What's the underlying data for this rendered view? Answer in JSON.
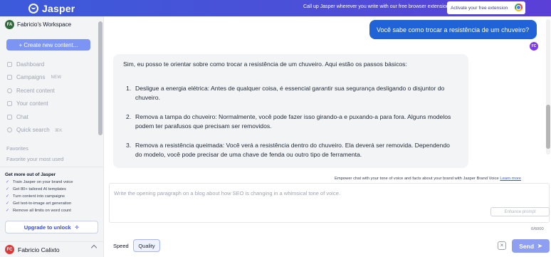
{
  "banner": {
    "brand": "Jasper",
    "message": "Call up Jasper wherever you write with our free browser extension!",
    "cta": "Activate your free extension",
    "cta_icon": "chrome-icon"
  },
  "sidebar": {
    "workspace": {
      "initials": "FA",
      "name": "Fabricio's Workspace"
    },
    "create_button": "+ Create new content...",
    "items": [
      {
        "label": "Dashboard",
        "icon": "home-icon"
      },
      {
        "label": "Campaigns",
        "icon": "campaigns-icon",
        "badge": "NEW"
      },
      {
        "label": "Recent content",
        "icon": "clock-icon"
      },
      {
        "label": "Your content",
        "icon": "folder-icon"
      },
      {
        "label": "Chat",
        "icon": "chat-icon"
      },
      {
        "label": "Quick search",
        "icon": "search-icon",
        "shortcut": "⌘K"
      }
    ],
    "favorites_title": "Favorites",
    "favorites_empty": "Favorite your most used",
    "promo": {
      "title": "Get more out of Jasper",
      "items": [
        "Train Jasper on your brand voice",
        "Get 80+ tailored AI templates",
        "Turn content into campaigns",
        "Get text-to-image art generation",
        "Remove all limits on word count"
      ]
    },
    "upgrade_button": "Upgrade to unlock",
    "user": {
      "initials": "FC",
      "name": "Fabricio Calixto"
    }
  },
  "chat": {
    "user_message": "Você sabe como trocar a resistência de um chuveiro?",
    "user_initials": "FC",
    "assistant_intro": "Sim, eu posso te orientar sobre como trocar a resistência de um chuveiro. Aqui estão os passos básicos:",
    "steps": [
      {
        "num": "1.",
        "text": "Desligue a energia elétrica: Antes de qualquer coisa, é essencial garantir sua segurança desligando o disjuntor do chuveiro."
      },
      {
        "num": "2.",
        "text": "Remova a tampa do chuveiro: Normalmente, você pode fazer isso girando-a e puxando-a para fora. Alguns modelos podem ter parafusos que precisam ser removidos."
      },
      {
        "num": "3.",
        "text": "Remova a resistência queimada: Você verá a resistência dentro do chuveiro. Ela deverá ser removida. Dependendo do modelo, você pode precisar de uma chave de fenda ou outro tipo de ferramenta."
      }
    ]
  },
  "composer": {
    "brand_voice_text": "Empower chat with your tone of voice and facts about your brand with Jasper Brand Voice",
    "learn_more": "Learn more",
    "placeholder": "Write the opening paragraph on a blog about how SEO is changing in a whimsical tone of voice.",
    "enhance_button": "Enhance prompt",
    "char_count": "0/6000",
    "modes": {
      "speed": "Speed",
      "quality": "Quality",
      "selected": "Quality"
    },
    "clear_icon": "clear-icon",
    "send_button": "Send"
  }
}
